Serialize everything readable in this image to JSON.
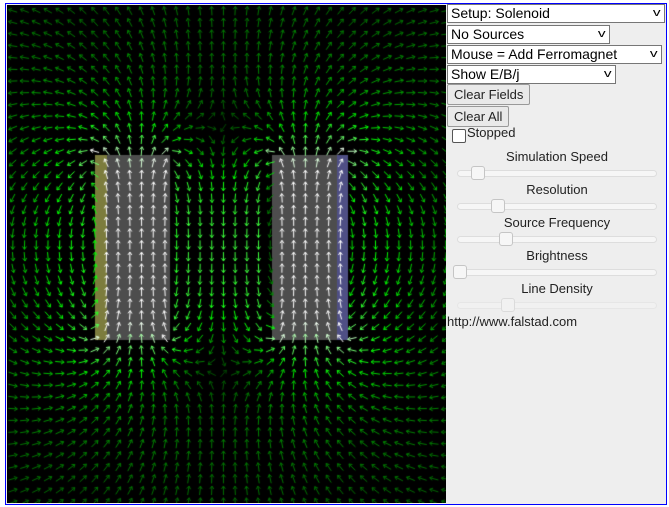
{
  "controls": {
    "setup_select": "Setup: Solenoid",
    "source_select": "No Sources",
    "mouse_select": "Mouse = Add Ferromagnet",
    "show_select": "Show E/B/j",
    "clear_fields": "Clear Fields",
    "clear_all": "Clear All",
    "stopped_label": "Stopped",
    "stopped_checked": false
  },
  "sliders": [
    {
      "label": "Simulation Speed",
      "value_pct": 10,
      "enabled": true
    },
    {
      "label": "Resolution",
      "value_pct": 20,
      "enabled": true
    },
    {
      "label": "Source Frequency",
      "value_pct": 24,
      "enabled": true
    },
    {
      "label": "Brightness",
      "value_pct": 1,
      "enabled": true
    },
    {
      "label": "Line Density",
      "value_pct": 25,
      "enabled": false
    }
  ],
  "footer_url": "http://www.falstad.com",
  "colors": {
    "border": "#0000ff",
    "field_bg": "#000000",
    "arrow": "#00ff00",
    "magnet": "#555555",
    "panel_bg": "#eeeeee"
  },
  "simulation": {
    "view": "magnetic field vectors",
    "objects": [
      "ferromagnet-left",
      "ferromagnet-right"
    ]
  }
}
